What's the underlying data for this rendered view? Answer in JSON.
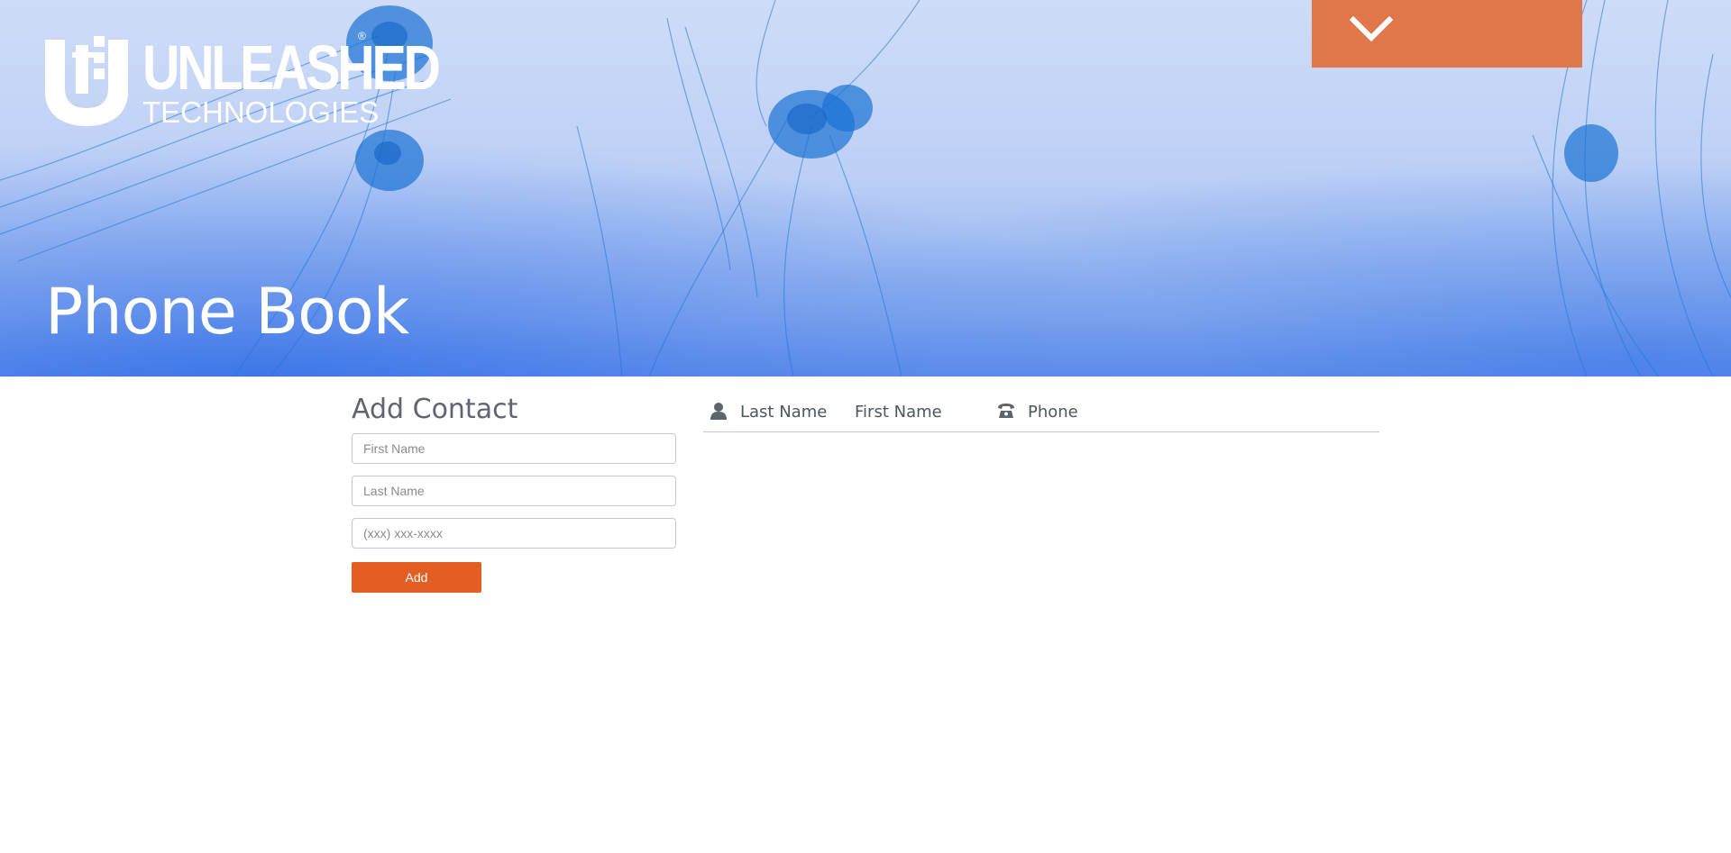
{
  "brand": {
    "name_line1": "UNLEASHED",
    "name_line2": "TECHNOLOGIES",
    "registered_mark": "®"
  },
  "hero": {
    "title": "Phone Book"
  },
  "menu_toggle": {
    "icon": "chevron-down-icon",
    "color": "#e0764a"
  },
  "add_contact": {
    "title": "Add Contact",
    "first_name_placeholder": "First Name",
    "last_name_placeholder": "Last Name",
    "phone_placeholder": "(xxx) xxx-xxxx",
    "add_label": "Add",
    "button_color": "#e35e22"
  },
  "contacts_table": {
    "columns": [
      {
        "label": "Last Name",
        "icon": "person-icon"
      },
      {
        "label": "First Name",
        "icon": ""
      },
      {
        "label": "Phone",
        "icon": "phone-icon"
      }
    ],
    "rows": []
  }
}
